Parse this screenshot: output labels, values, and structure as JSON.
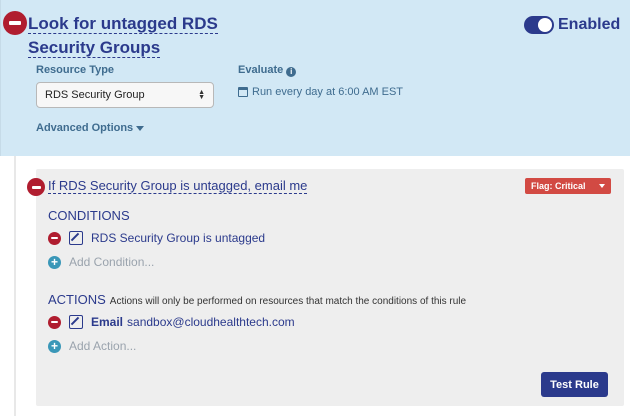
{
  "rule": {
    "title": "Look for untagged RDS Security Groups",
    "enabled_label": "Enabled",
    "resource_type_label": "Resource Type",
    "resource_type_value": "RDS Security Group",
    "evaluate_label": "Evaluate",
    "schedule": "Run every day at 6:00 AM EST",
    "advanced_options_label": "Advanced Options"
  },
  "condition_block": {
    "title": "If RDS Security Group is untagged, email me",
    "flag_label": "Flag: Critical",
    "conditions_heading": "CONDITIONS",
    "conditions": [
      {
        "text": "RDS Security Group is untagged"
      }
    ],
    "add_condition_label": "Add Condition...",
    "actions_heading": "ACTIONS",
    "actions_note": "Actions will only be performed on resources that match the conditions of this rule",
    "actions": [
      {
        "type": "Email",
        "target": "sandbox@cloudhealthtech.com"
      }
    ],
    "add_action_label": "Add Action...",
    "test_button_label": "Test Rule"
  },
  "colors": {
    "header_bg": "#d2e8f5",
    "primary": "#2b3a8c",
    "danger": "#b01d2f",
    "flag": "#d24a43",
    "add": "#3a97b8"
  }
}
